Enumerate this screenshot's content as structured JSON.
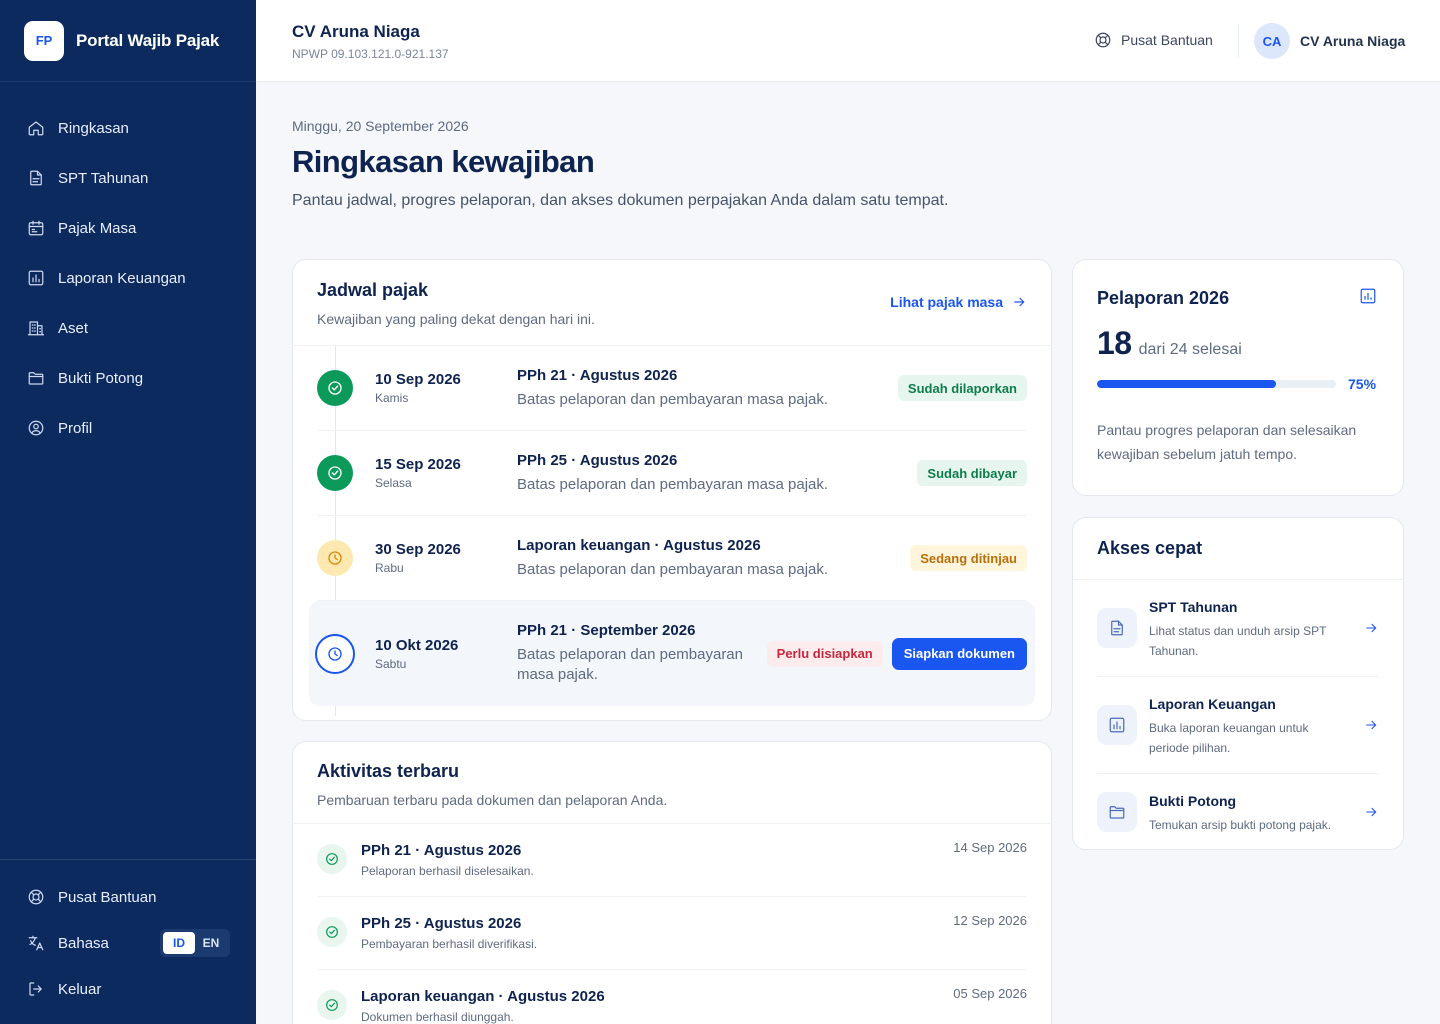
{
  "brand": {
    "logo": "FP",
    "name": "Portal Wajib Pajak"
  },
  "nav": {
    "items": [
      {
        "label": "Ringkasan",
        "icon": "home-icon"
      },
      {
        "label": "SPT Tahunan",
        "icon": "document-icon"
      },
      {
        "label": "Pajak Masa",
        "icon": "calendar-icon"
      },
      {
        "label": "Laporan Keuangan",
        "icon": "bar-chart-icon"
      },
      {
        "label": "Aset",
        "icon": "building-icon"
      },
      {
        "label": "Bukti Potong",
        "icon": "folder-icon"
      },
      {
        "label": "Profil",
        "icon": "user-circle-icon"
      }
    ],
    "help": "Pusat Bantuan",
    "language": "Bahasa",
    "lang_id": "ID",
    "lang_en": "EN",
    "logout": "Keluar"
  },
  "topbar": {
    "company_name": "CV Aruna Niaga",
    "npwp": "NPWP 09.103.121.0-921.137",
    "help": "Pusat Bantuan",
    "avatar": "CA",
    "user_name": "CV Aruna Niaga"
  },
  "header": {
    "date": "Minggu, 20 September 2026",
    "title": "Ringkasan kewajiban",
    "description": "Pantau jadwal, progres pelaporan, dan akses dokumen perpajakan Anda dalam satu tempat."
  },
  "schedule": {
    "title": "Jadwal pajak",
    "subtitle": "Kewajiban yang paling dekat dengan hari ini.",
    "link": "Lihat pajak masa",
    "rows": [
      {
        "date": "10 Sep 2026",
        "day": "Kamis",
        "title": "PPh 21 · Agustus 2026",
        "desc": "Batas pelaporan dan pembayaran masa pajak.",
        "badge": "Sudah dilaporkan"
      },
      {
        "date": "15 Sep 2026",
        "day": "Selasa",
        "title": "PPh 25 · Agustus 2026",
        "desc": "Batas pelaporan dan pembayaran masa pajak.",
        "badge": "Sudah dibayar"
      },
      {
        "date": "30 Sep 2026",
        "day": "Rabu",
        "title": "Laporan keuangan · Agustus 2026",
        "desc": "Batas pelaporan dan pembayaran masa pajak.",
        "badge": "Sedang ditinjau"
      },
      {
        "date": "10 Okt 2026",
        "day": "Sabtu",
        "title": "PPh 21 · September 2026",
        "desc": "Batas pelaporan dan pembayaran masa pajak.",
        "badge": "Perlu disiapkan",
        "action": "Siapkan dokumen"
      }
    ]
  },
  "activity": {
    "title": "Aktivitas terbaru",
    "subtitle": "Pembaruan terbaru pada dokumen dan pelaporan Anda.",
    "items": [
      {
        "title": "PPh 21 · Agustus 2026",
        "desc": "Pelaporan berhasil diselesaikan.",
        "date": "14 Sep 2026"
      },
      {
        "title": "PPh 25 · Agustus 2026",
        "desc": "Pembayaran berhasil diverifikasi.",
        "date": "12 Sep 2026"
      },
      {
        "title": "Laporan keuangan · Agustus 2026",
        "desc": "Dokumen berhasil diunggah.",
        "date": "05 Sep 2026"
      }
    ]
  },
  "report": {
    "title": "Pelaporan 2026",
    "count": "18",
    "count_rest": "dari 24 selesai",
    "progress": 0.75,
    "percent": "75%",
    "description": "Pantau progres pelaporan dan selesaikan kewajiban sebelum jatuh tempo."
  },
  "quick": {
    "title": "Akses cepat",
    "items": [
      {
        "title": "SPT Tahunan",
        "desc": "Lihat status dan unduh arsip SPT Tahunan.",
        "icon": "document-icon"
      },
      {
        "title": "Laporan Keuangan",
        "desc": "Buka laporan keuangan untuk periode pilihan.",
        "icon": "bar-chart-icon"
      },
      {
        "title": "Bukti Potong",
        "desc": "Temukan arsip bukti potong pajak.",
        "icon": "folder-icon"
      }
    ]
  },
  "colors": {
    "sidebar": "#0c2a5e",
    "accent": "#1a56f0",
    "success": "#0c9a5b",
    "warning": "#d98a0a",
    "danger": "#c6283d"
  }
}
